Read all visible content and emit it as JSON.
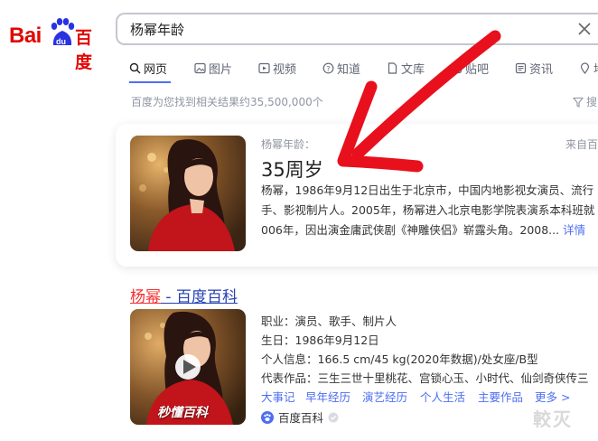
{
  "logo": {
    "part1": "Bai",
    "part2": "du",
    "part3": "百度"
  },
  "search": {
    "query": "杨幂年龄"
  },
  "tabs": [
    {
      "label": "网页",
      "icon": "search-icon"
    },
    {
      "label": "图片",
      "icon": "image-icon"
    },
    {
      "label": "视频",
      "icon": "video-icon"
    },
    {
      "label": "知道",
      "icon": "zhidao-icon"
    },
    {
      "label": "文库",
      "icon": "doc-icon"
    },
    {
      "label": "贴吧",
      "icon": "tieba-icon"
    },
    {
      "label": "资讯",
      "icon": "news-icon"
    },
    {
      "label": "地",
      "icon": "map-icon"
    }
  ],
  "result_count": "百度为您找到相关结果约35,500,000个",
  "filter_label": "搜",
  "answer_card": {
    "label": "杨幂年龄：",
    "answer": "35周岁",
    "source": "来自百",
    "lines": [
      "杨幂，1986年9月12日出生于北京市，中国内地影视女演员、流行",
      "手、影视制片人。2005年，杨幂进入北京电影学院表演系本科班就",
      "006年，因出演金庸武侠剧《神雕侠侣》崭露头角。2008..."
    ],
    "more": "详情"
  },
  "baike_result": {
    "title_highlight": "杨幂",
    "title_rest": " - 百度百科",
    "rows": [
      "职业：演员、歌手、制片人",
      "生日：1986年9月12日",
      "个人信息：166.5 cm/45 kg(2020年数据)/处女座/B型",
      "代表作品：三生三世十里桃花、宫锁心玉、小时代、仙剑奇侠传三"
    ],
    "links": [
      "大事记",
      "早年经历",
      "演艺经历",
      "个人生活",
      "主要作品",
      "更多 >"
    ],
    "source": "百度百科",
    "video_brand": "秒懂百科"
  },
  "watermark": "較灭",
  "colors": {
    "brand_red": "#e10602",
    "link_blue": "#2440b3",
    "accent_blue": "#4e6ef2",
    "highlight_red": "#f73131"
  }
}
